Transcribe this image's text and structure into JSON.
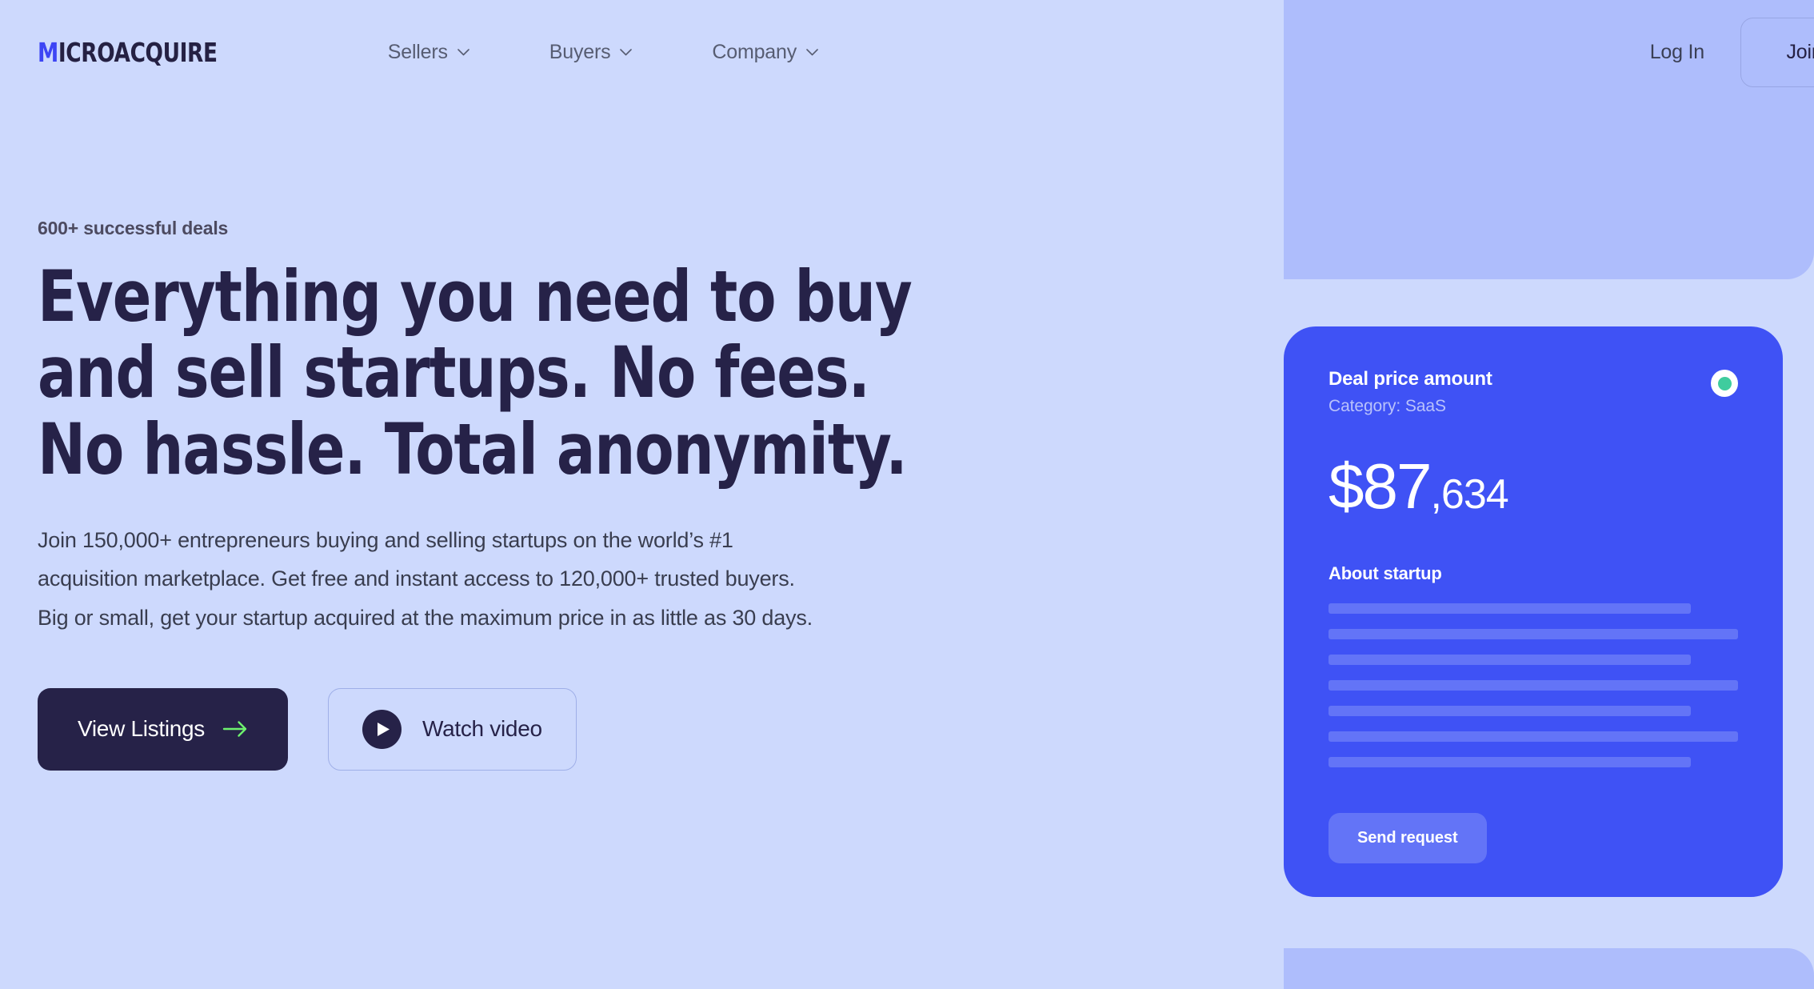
{
  "brand": {
    "logo_first_letter": "M",
    "logo_rest": "ICROACQUIRE",
    "logo_accent_color": "#3d45f4",
    "logo_color": "#252143"
  },
  "nav": {
    "items": [
      {
        "label": "Sellers",
        "icon": "chevron-down-icon"
      },
      {
        "label": "Buyers",
        "icon": "chevron-down-icon"
      },
      {
        "label": "Company",
        "icon": "chevron-down-icon"
      }
    ],
    "login_label": "Log In",
    "join_label": "Join"
  },
  "hero": {
    "eyebrow": "600+ successful deals",
    "headline_line_1": "Everything you need to buy",
    "headline_line_2": "and sell startups. No fees.",
    "headline_line_3": "No hassle. Total anonymity.",
    "subcopy_line_1": "Join 150,000+ entrepreneurs buying and selling startups on the world’s #1",
    "subcopy_line_2": "acquisition marketplace. Get free and instant access to 120,000+ trusted buyers.",
    "subcopy_line_3": "Big or small, get your startup acquired at the maximum price in as little as 30 days.",
    "primary_cta": "View Listings",
    "primary_cta_icon": "arrow-right-icon",
    "secondary_cta": "Watch video",
    "secondary_cta_icon": "play-icon"
  },
  "deal_card": {
    "title": "Deal price amount",
    "category": "Category: SaaS",
    "amount_major": "$87",
    "amount_minor": ",634",
    "about_title": "About startup",
    "skeleton_widths": [
      "w-a",
      "w-b",
      "w-a",
      "w-b",
      "w-a",
      "w-b",
      "w-a"
    ],
    "send_label": "Send request",
    "status_indicator": "online-status-dot"
  },
  "colors": {
    "page_background": "#cdd9fd",
    "panel_lavender": "#aebdfc",
    "card_blue": "#3f52f5",
    "card_skeleton": "#6374f7",
    "navy": "#262248",
    "accent_green": "#3fcc9e",
    "arrow_green": "#6ef16e"
  }
}
